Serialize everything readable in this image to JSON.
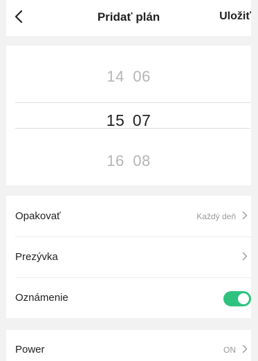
{
  "header": {
    "title": "Pridať plán",
    "save_label": "Uložiť",
    "back_icon": "chevron-left-icon"
  },
  "time_picker": {
    "previous": {
      "hour": "14",
      "minute": "06"
    },
    "selected": {
      "hour": "15",
      "minute": "07"
    },
    "next": {
      "hour": "16",
      "minute": "08"
    }
  },
  "settings": {
    "repeat": {
      "label": "Opakovať",
      "value": "Každý deň"
    },
    "nickname": {
      "label": "Prezývka",
      "value": ""
    },
    "notification": {
      "label": "Oznámenie",
      "enabled": true
    }
  },
  "power": {
    "label": "Power",
    "value": "ON"
  },
  "colors": {
    "accent": "#2ec27e",
    "background": "#f2f2f2",
    "muted_text": "#b5b5b5"
  }
}
